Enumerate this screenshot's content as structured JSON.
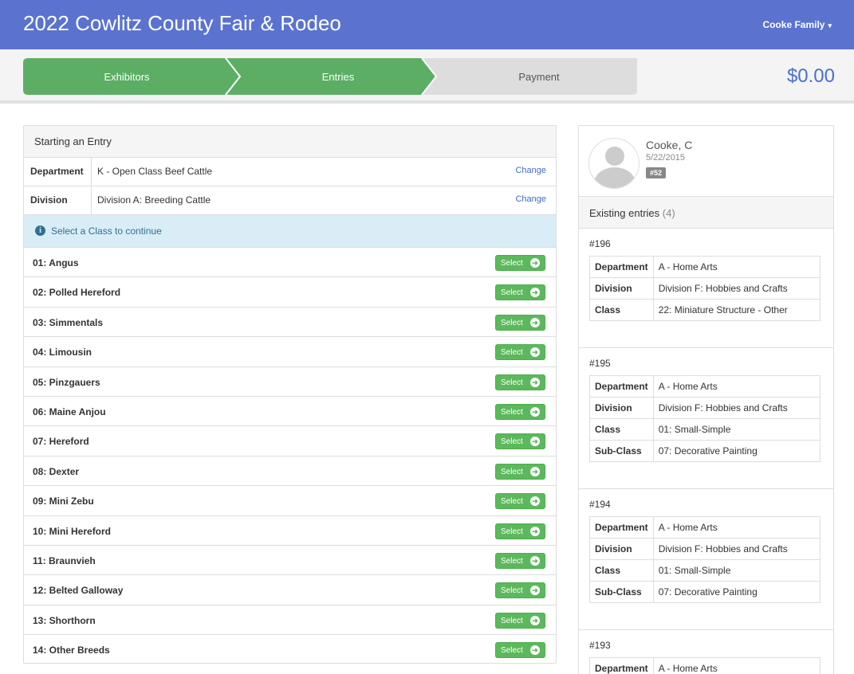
{
  "header": {
    "title": "2022 Cowlitz County Fair & Rodeo",
    "user_menu": "Cooke Family",
    "caret": "▾"
  },
  "steps": [
    {
      "label": "Exhibitors",
      "state": "done",
      "color": "#5cae64"
    },
    {
      "label": "Entries",
      "state": "active",
      "color": "#5cae64"
    },
    {
      "label": "Payment",
      "state": "pending",
      "color": "#dddddd"
    }
  ],
  "total": "$0.00",
  "entry": {
    "panel_title": "Starting an Entry",
    "department": {
      "label": "Department",
      "value": "K - Open Class Beef Cattle",
      "change": "Change"
    },
    "division": {
      "label": "Division",
      "value": "Division A: Breeding Cattle",
      "change": "Change"
    },
    "alert": "Select a Class to continue",
    "select_label": "Select",
    "classes": [
      "01: Angus",
      "02: Polled Hereford",
      "03: Simmentals",
      "04: Limousin",
      "05: Pinzgauers",
      "06: Maine Anjou",
      "07: Hereford",
      "08: Dexter",
      "09: Mini Zebu",
      "10: Mini Hereford",
      "11: Braunvieh",
      "12: Belted Galloway",
      "13: Shorthorn",
      "14: Other Breeds"
    ]
  },
  "exhibitor": {
    "name": "Cooke, C",
    "date": "5/22/2015",
    "badge": "#52"
  },
  "existing": {
    "title": "Existing entries",
    "count": "(4)",
    "entries": [
      {
        "num": "#196",
        "rows": [
          {
            "k": "Department",
            "v": "A - Home Arts"
          },
          {
            "k": "Division",
            "v": "Division F: Hobbies and Crafts"
          },
          {
            "k": "Class",
            "v": "22: Miniature Structure - Other"
          }
        ]
      },
      {
        "num": "#195",
        "rows": [
          {
            "k": "Department",
            "v": "A - Home Arts"
          },
          {
            "k": "Division",
            "v": "Division F: Hobbies and Crafts"
          },
          {
            "k": "Class",
            "v": "01: Small-Simple"
          },
          {
            "k": "Sub-Class",
            "v": "07: Decorative Painting"
          }
        ]
      },
      {
        "num": "#194",
        "rows": [
          {
            "k": "Department",
            "v": "A - Home Arts"
          },
          {
            "k": "Division",
            "v": "Division F: Hobbies and Crafts"
          },
          {
            "k": "Class",
            "v": "01: Small-Simple"
          },
          {
            "k": "Sub-Class",
            "v": "07: Decorative Painting"
          }
        ]
      },
      {
        "num": "#193",
        "rows": [
          {
            "k": "Department",
            "v": "A - Home Arts"
          }
        ]
      }
    ]
  }
}
